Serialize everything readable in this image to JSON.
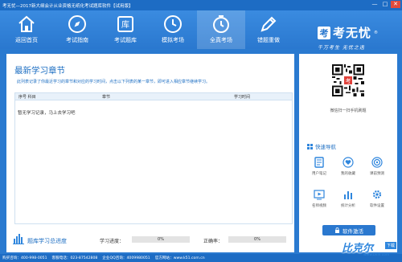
{
  "window": {
    "title": "考无忧—2017新大纲会计从业资格无纸化考试题库软件【试用版】",
    "buttons": [
      "—",
      "□",
      "✕"
    ]
  },
  "nav": [
    {
      "label": "返回首页",
      "icon": "home-icon"
    },
    {
      "label": "考试指南",
      "icon": "compass-icon"
    },
    {
      "label": "考试题库",
      "icon": "library-icon"
    },
    {
      "label": "模拟考场",
      "icon": "clock-icon"
    },
    {
      "label": "全真考场",
      "icon": "timer-icon",
      "active": true
    },
    {
      "label": "错题重做",
      "icon": "pen-icon"
    }
  ],
  "brand": {
    "logo_char": "考",
    "name": "考无忧",
    "mark": "®",
    "slogan": "千万考生  无忧之选"
  },
  "main": {
    "title": "最新学习章节",
    "description": "此列表记录了你最近学习的章节和对应的学习时间，点击以下列表的某一章节，即可进入相应章节继续学习。",
    "columns": [
      "序号 科目",
      "章节",
      "学习时间"
    ],
    "empty_text": "暂无学习记录，马上去学习吧"
  },
  "bottom": {
    "lib_title": "题库学习总进度",
    "progress_label": "学习进度：",
    "progress_value": "0%",
    "progress_fraction": 0,
    "accuracy_label": "正确率：",
    "accuracy_value": "0%",
    "accuracy_fraction": 0
  },
  "right": {
    "qr_caption": "微信扫一扫手机刷题",
    "quick_title": "快速导航",
    "items": [
      {
        "label": "用户笔记",
        "icon": "notebook-icon",
        "color": "#2f86dd"
      },
      {
        "label": "我的收藏",
        "icon": "heart-icon",
        "color": "#2f86dd"
      },
      {
        "label": "课前预测",
        "icon": "target-icon",
        "color": "#2f86dd"
      },
      {
        "label": "名师视频",
        "icon": "video-icon",
        "color": "#2f86dd"
      },
      {
        "label": "统计分析",
        "icon": "bar-chart-icon",
        "color": "#2f86dd"
      },
      {
        "label": "软件设置",
        "icon": "gear-icon",
        "color": "#2f86dd"
      }
    ],
    "activate_label": "软件激活"
  },
  "status": {
    "items": [
      "购买咨询：400-998-0051",
      "客服电话：023-87542808",
      "企业QQ咨询：4009980051",
      "官方网站：www.k51.com.cn"
    ]
  },
  "watermark": {
    "text": "比克尔",
    "badge": "下载",
    "url": "www.bkill.com"
  },
  "colors": {
    "primary": "#2a78cf",
    "accent_text": "#1e6fc3",
    "header_bg": "#e8f1fa"
  }
}
